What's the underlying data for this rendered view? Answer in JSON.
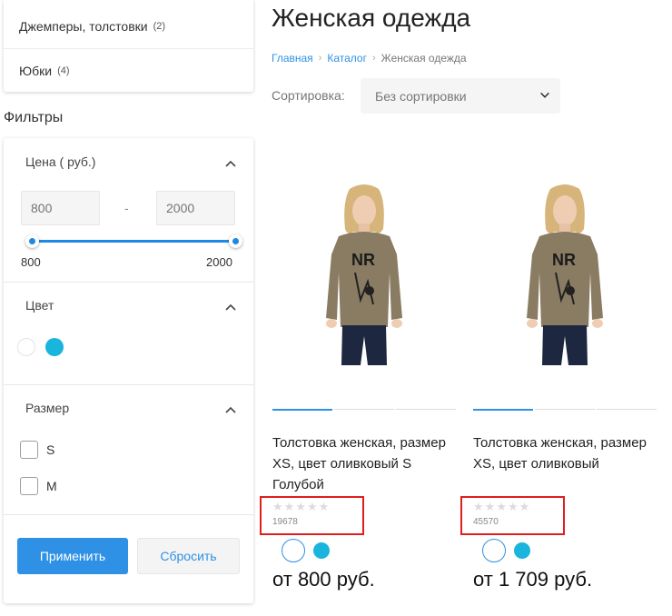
{
  "categories": [
    {
      "label": "Джемперы, толстовки",
      "count": "(2)"
    },
    {
      "label": "Юбки",
      "count": "(4)"
    }
  ],
  "filters": {
    "heading": "Фильтры",
    "price": {
      "title": "Цена ( руб.)",
      "min_placeholder": "800",
      "max_placeholder": "2000",
      "dash": "-",
      "range_min_label": "800",
      "range_max_label": "2000"
    },
    "color": {
      "title": "Цвет",
      "options": [
        {
          "name": "white",
          "hex": "#ffffff"
        },
        {
          "name": "blue",
          "hex": "#1ab5dc"
        }
      ]
    },
    "size": {
      "title": "Размер",
      "options": [
        "S",
        "M"
      ]
    },
    "apply_label": "Применить",
    "reset_label": "Сбросить"
  },
  "page": {
    "title": "Женская одежда",
    "breadcrumb": [
      "Главная",
      "Каталог",
      "Женская одежда"
    ],
    "sort_label": "Сортировка:",
    "sort_value": "Без сортировки"
  },
  "products": [
    {
      "name": "Толстовка женская, размер XS, цвет оливковый S Голубой",
      "article": "19678",
      "price": "от 800 руб.",
      "rating": 0
    },
    {
      "name": "Толстовка женская, размер XS, цвет оливковый",
      "article": "45570",
      "price": "от 1 709 руб.",
      "rating": 0
    }
  ],
  "colors": {
    "accent": "#2e91e5",
    "swatch_blue": "#1ab5dc",
    "highlight": "#e01e1e"
  }
}
